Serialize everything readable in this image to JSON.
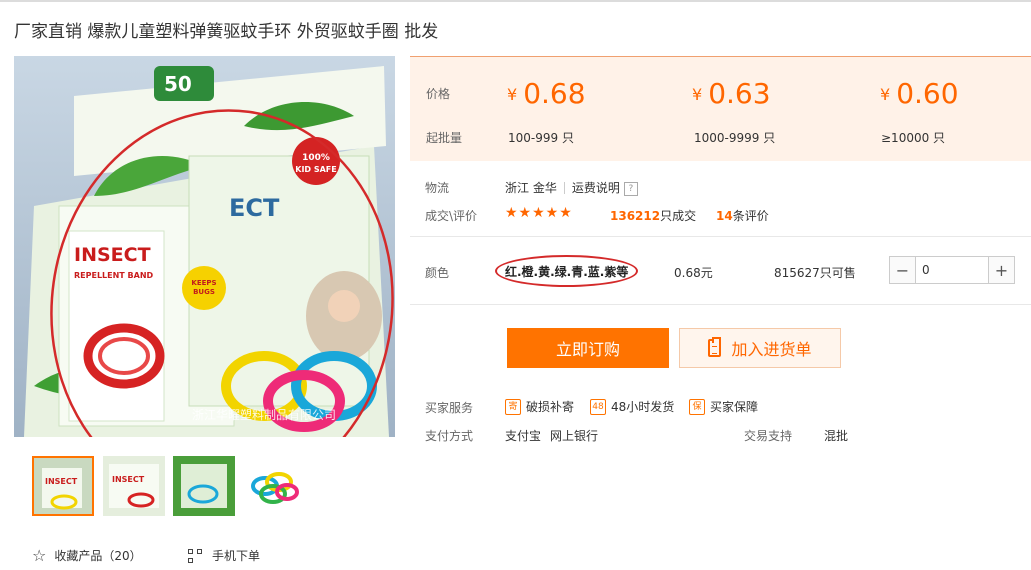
{
  "product": {
    "title": "厂家直销 爆款儿童塑料弹簧驱蚊手环 外贸驱蚊手圈 批发",
    "image_text": {
      "brand": "INSECT",
      "sub": "REPELLENT BAND",
      "count": "50",
      "kid_safe": "100% KID SAFE",
      "watermark": "浙江华曜塑料制品有限公司"
    }
  },
  "price_panel": {
    "price_label": "价格",
    "moq_label": "起批量",
    "currency": "¥",
    "tiers": [
      {
        "price": "0.68",
        "moq": "100-999 只"
      },
      {
        "price": "0.63",
        "moq": "1000-9999 只"
      },
      {
        "price": "0.60",
        "moq": "≥10000 只"
      }
    ]
  },
  "logistics": {
    "label": "物流",
    "location": "浙江 金华",
    "shipping_link": "运费说明",
    "help": "?"
  },
  "deals": {
    "label": "成交\\评价",
    "stars": "★★★★★",
    "sold_count": "136212",
    "sold_suffix": "只成交",
    "review_count": "14",
    "review_suffix": "条评价"
  },
  "color_row": {
    "label": "颜色",
    "value": "红.橙.黄.绿.青.蓝.紫等",
    "price": "0.68元",
    "stock": "815627只可售",
    "quantity": "0",
    "minus": "−",
    "plus": "+"
  },
  "actions": {
    "buy_now": "立即订购",
    "add_to_list": "加入进货单"
  },
  "services": {
    "label": "买家服务",
    "items": [
      {
        "icon": "寄",
        "text": "破损补寄"
      },
      {
        "icon": "48",
        "text": "48小时发货"
      },
      {
        "icon": "保",
        "text": "买家保障"
      }
    ]
  },
  "payment": {
    "label": "支付方式",
    "methods": "支付宝",
    "methods2": "网上银行",
    "trade_label": "交易支持",
    "trade_value": "混批"
  },
  "bottom": {
    "favorite": "收藏产品（20）",
    "mobile_order": "手机下单"
  },
  "colors": {
    "accent": "#ff6600",
    "button": "#ff7300",
    "panel_bg": "#fff2e8"
  }
}
